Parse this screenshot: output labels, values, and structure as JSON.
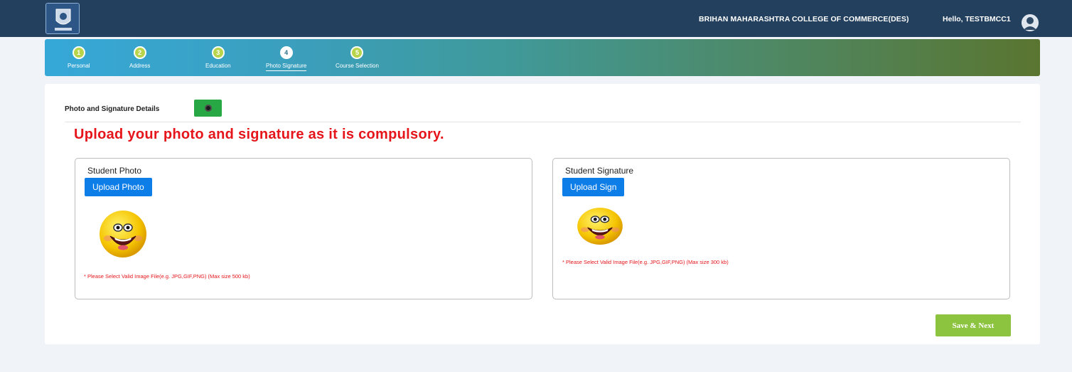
{
  "header": {
    "college_name": "BRIHAN MAHARASHTRA COLLEGE OF COMMERCE(DES)",
    "greeting": "Hello, TESTBMCC1",
    "colors": {
      "topbar": "#23415f"
    }
  },
  "steps": [
    {
      "number": "1",
      "label": "Personal"
    },
    {
      "number": "2",
      "label": "Address"
    },
    {
      "number": "3",
      "label": "Education"
    },
    {
      "number": "4",
      "label": "Photo Signature",
      "active": true
    },
    {
      "number": "5",
      "label": "Course Selection"
    }
  ],
  "section": {
    "title": "Photo and Signature Details",
    "warning": "Upload your photo and signature as it is compulsory."
  },
  "photo": {
    "title": "Student Photo",
    "button": "Upload Photo",
    "hint_marker": "*",
    "hint": "Please Select Valid Image File(e.g. JPG,GIF,PNG) (Max size 500 kb)",
    "icon": "smiley-face"
  },
  "signature": {
    "title": "Student Signature",
    "button": "Upload Sign",
    "hint_marker": "*",
    "hint": "Please Select Valid Image File(e.g. JPG,GIF,PNG) (Max size 300 kb)",
    "icon": "smiley-face"
  },
  "actions": {
    "save_next": "Save & Next"
  },
  "colors": {
    "accent_blue": "#0d7de8",
    "warning_red": "#e5151b",
    "save_green": "#8cc43f",
    "toggle_green": "#28a745"
  }
}
